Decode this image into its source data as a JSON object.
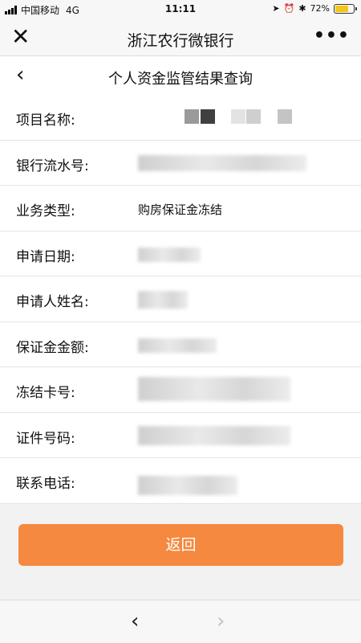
{
  "status_bar": {
    "carrier": "中国移动",
    "network": "4G",
    "time": "11:11",
    "battery": "72%",
    "battery_level": 0.72,
    "icons": [
      "location-icon",
      "alarm-icon",
      "bluetooth-icon"
    ]
  },
  "navbar": {
    "title": "浙江农行微银行",
    "close_icon": "close-icon",
    "more_icon": "more-icon"
  },
  "page": {
    "title": "个人资金监管结果查询",
    "back_icon": "chevron-left-icon"
  },
  "rows": [
    {
      "label": "项目名称:",
      "value": ""
    },
    {
      "label": "银行流水号:",
      "value": ""
    },
    {
      "label": "业务类型:",
      "value": "购房保证金冻结"
    },
    {
      "label": "申请日期:",
      "value": ""
    },
    {
      "label": "申请人姓名:",
      "value": ""
    },
    {
      "label": "保证金金额:",
      "value": ""
    },
    {
      "label": "冻结卡号:",
      "value": ""
    },
    {
      "label": "证件号码:",
      "value": ""
    },
    {
      "label": "联系电话:",
      "value": ""
    }
  ],
  "button": {
    "label": "返回"
  },
  "toolbar": {
    "back_icon": "chevron-left-icon",
    "forward_icon": "chevron-right-icon"
  },
  "colors": {
    "accent": "#f5893f",
    "background": "#f2f2f2",
    "battery": "#f5c518"
  }
}
